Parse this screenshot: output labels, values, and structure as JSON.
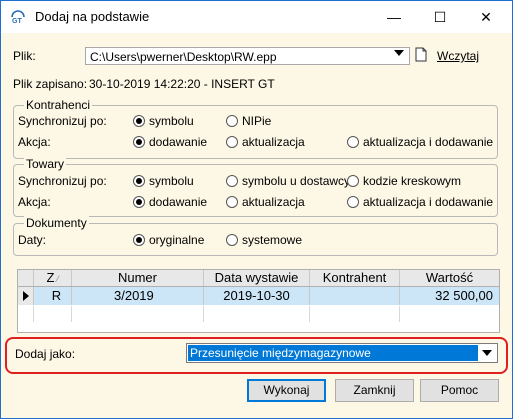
{
  "window": {
    "title": "Dodaj na podstawie",
    "icon": "gt-logo-icon"
  },
  "titlebar_buttons": {
    "minimize": "—",
    "maximize": "☐",
    "close": "✕"
  },
  "file": {
    "label": "Plik:",
    "path": "C:\\Users\\pwerner\\Desktop\\RW.epp",
    "load_label": "Wczytaj",
    "saved_label": "Plik zapisano:",
    "saved_value": "30-10-2019 14:22:20 - INSERT GT"
  },
  "kontrahenci": {
    "title": "Kontrahenci",
    "sync_label": "Synchronizuj po:",
    "sync_options": [
      {
        "label": "symbolu",
        "selected": true
      },
      {
        "label": "NIPie",
        "selected": false
      }
    ],
    "action_label": "Akcja:",
    "action_options": [
      {
        "label": "dodawanie",
        "selected": true
      },
      {
        "label": "aktualizacja",
        "selected": false
      },
      {
        "label": "aktualizacja i dodawanie",
        "selected": false
      }
    ]
  },
  "towary": {
    "title": "Towary",
    "sync_label": "Synchronizuj po:",
    "sync_options": [
      {
        "label": "symbolu",
        "selected": true
      },
      {
        "label": "symbolu u dostawcy",
        "selected": false
      },
      {
        "label": "kodzie kreskowym",
        "selected": false
      }
    ],
    "action_label": "Akcja:",
    "action_options": [
      {
        "label": "dodawanie",
        "selected": true
      },
      {
        "label": "aktualizacja",
        "selected": false
      },
      {
        "label": "aktualizacja i dodawanie",
        "selected": false
      }
    ]
  },
  "dokumenty": {
    "title": "Dokumenty",
    "dates_label": "Daty:",
    "date_options": [
      {
        "label": "oryginalne",
        "selected": true
      },
      {
        "label": "systemowe",
        "selected": false
      }
    ]
  },
  "grid": {
    "headers": [
      "Z",
      "Numer",
      "Data wystawie",
      "Kontrahent",
      "Wartość"
    ],
    "rows": [
      {
        "z": "R",
        "numer": "3/2019",
        "data": "2019-10-30",
        "kontrahent": "",
        "wartosc": "32 500,00"
      }
    ]
  },
  "add_as": {
    "label": "Dodaj jako:",
    "value": "Przesunięcie międzymagazynowe"
  },
  "buttons": {
    "execute": "Wykonaj",
    "close": "Zamknij",
    "help": "Pomoc"
  },
  "colors": {
    "highlight": "#e02020",
    "selection": "#0078d7",
    "row_selected": "#cde6f7",
    "background": "#fdf7e6"
  }
}
